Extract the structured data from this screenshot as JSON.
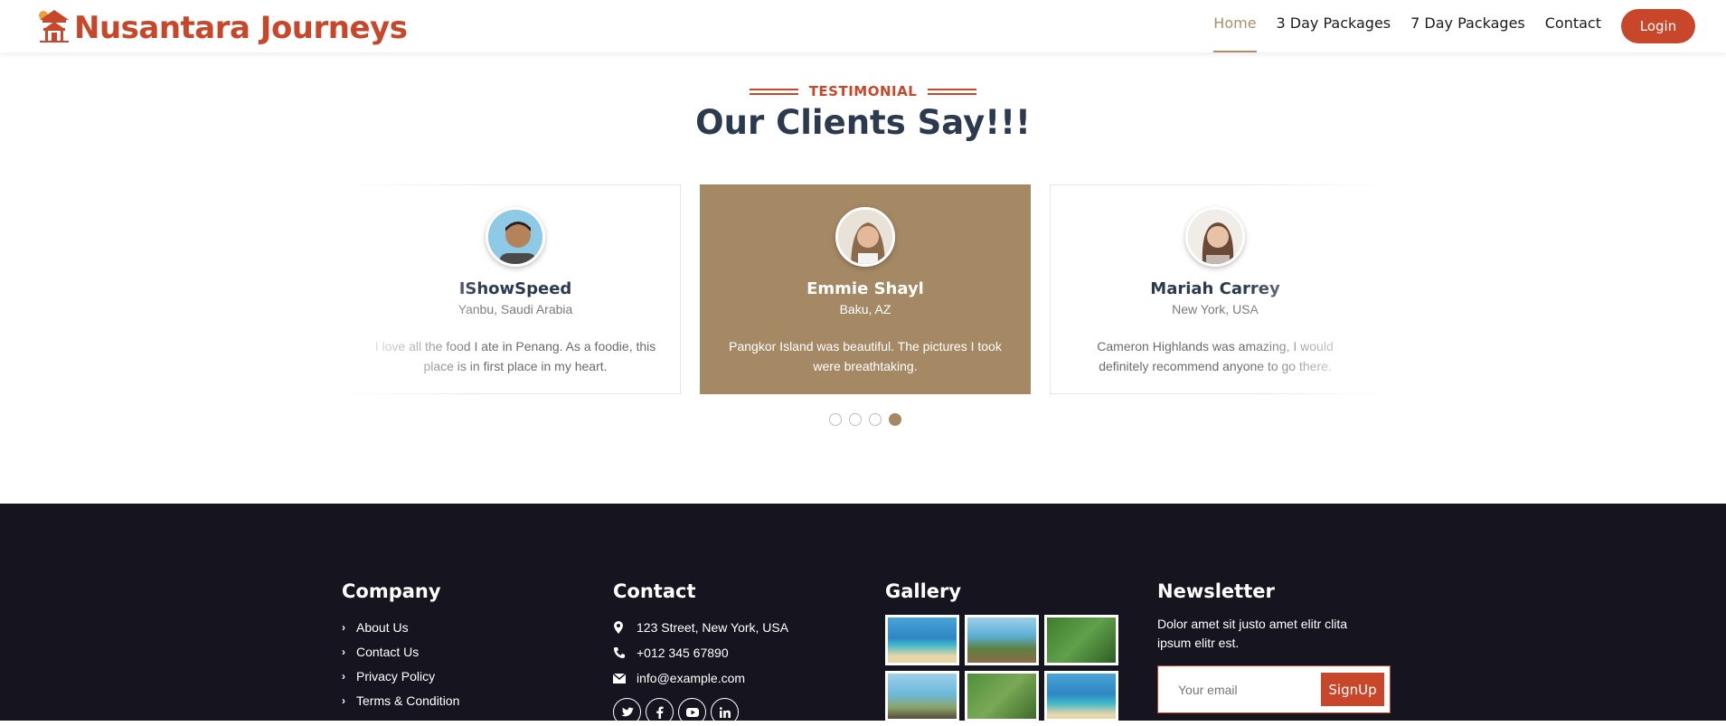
{
  "brand": {
    "title": "Nusantara Journeys"
  },
  "nav": {
    "items": [
      {
        "label": "Home"
      },
      {
        "label": "3 Day Packages"
      },
      {
        "label": "7 Day Packages"
      },
      {
        "label": "Contact"
      }
    ],
    "login_label": "Login"
  },
  "testimonial": {
    "tag": "TESTIMONIAL",
    "title": "Our Clients Say!!!",
    "cards": [
      {
        "name": "IShowSpeed",
        "location": "Yanbu, Saudi Arabia",
        "text": "I love all the food I ate in Penang. As a foodie, this place is in first place in my heart."
      },
      {
        "name": "Emmie Shayl",
        "location": "Baku, AZ",
        "text": "Pangkor Island was beautiful. The pictures I took were breathtaking."
      },
      {
        "name": "Mariah Carrey",
        "location": "New York, USA",
        "text": "Cameron Highlands was amazing, I would definitely recommend anyone to go there."
      }
    ],
    "active_dot": 4
  },
  "footer": {
    "company": {
      "title": "Company",
      "links": [
        "About Us",
        "Contact Us",
        "Privacy Policy",
        "Terms & Condition"
      ]
    },
    "contact": {
      "title": "Contact",
      "address": "123 Street, New York, USA",
      "phone": "+012 345 67890",
      "email": "info@example.com",
      "social_icons": [
        "twitter-icon",
        "facebook-icon",
        "youtube-icon",
        "linkedin-icon"
      ]
    },
    "gallery": {
      "title": "Gallery"
    },
    "newsletter": {
      "title": "Newsletter",
      "text": "Dolor amet sit justo amet elitr clita ipsum elitr est.",
      "placeholder": "Your email",
      "button": "SignUp"
    }
  },
  "colors": {
    "brand": "#c8472a",
    "accent": "#a58964",
    "footer_bg": "#15141f",
    "heading": "#2b3a4f"
  }
}
